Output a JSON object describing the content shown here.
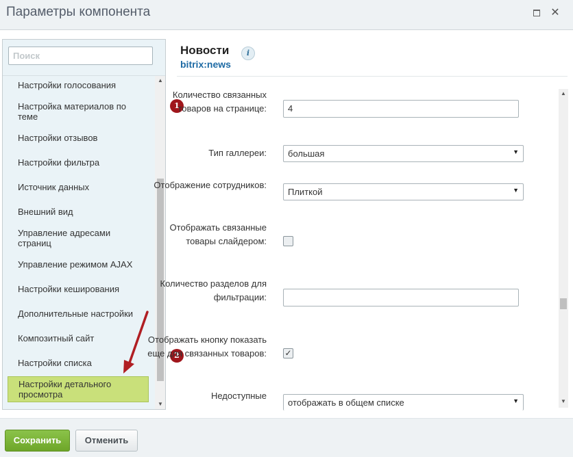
{
  "window": {
    "title": "Параметры компонента"
  },
  "sidebar": {
    "search_placeholder": "Поиск",
    "items": [
      {
        "label": "Настройки голосования"
      },
      {
        "label": "Настройка материалов по теме"
      },
      {
        "label": "Настройки отзывов"
      },
      {
        "label": "Настройки фильтра"
      },
      {
        "label": "Источник данных"
      },
      {
        "label": "Внешний вид"
      },
      {
        "label": "Управление адресами страниц"
      },
      {
        "label": "Управление режимом AJAX"
      },
      {
        "label": "Настройки кеширования"
      },
      {
        "label": "Дополнительные настройки"
      },
      {
        "label": "Композитный сайт"
      },
      {
        "label": "Настройки списка"
      },
      {
        "label": "Настройки детального просмотра",
        "active": true
      }
    ]
  },
  "component": {
    "title": "Новости",
    "code": "bitrix:news",
    "info_icon": "info-icon"
  },
  "form": {
    "related_count": {
      "label": "Количество связанных товаров на странице:",
      "value": "4",
      "badge": "1"
    },
    "gallery_type": {
      "label": "Тип галлереи:",
      "value": "большая"
    },
    "staff_display": {
      "label": "Отображение сотрудников:",
      "value": "Плиткой"
    },
    "related_slider": {
      "label": "Отображать связанные товары слайдером:",
      "checked": false
    },
    "filter_sections": {
      "label": "Количество разделов для фильтрации:",
      "value": ""
    },
    "show_more": {
      "label": "Отображать кнопку показать еще для связанных товаров:",
      "checked": true,
      "badge": "2"
    },
    "unavailable": {
      "label": "Недоступные",
      "value": "отображать в общем списке"
    }
  },
  "footer": {
    "save_label": "Сохранить",
    "cancel_label": "Отменить"
  },
  "colors": {
    "active_item": "#c9e07a",
    "save_button": "#7ab332",
    "badge": "#a0161c",
    "link": "#1d6aa4",
    "arrow": "#b01e23"
  }
}
